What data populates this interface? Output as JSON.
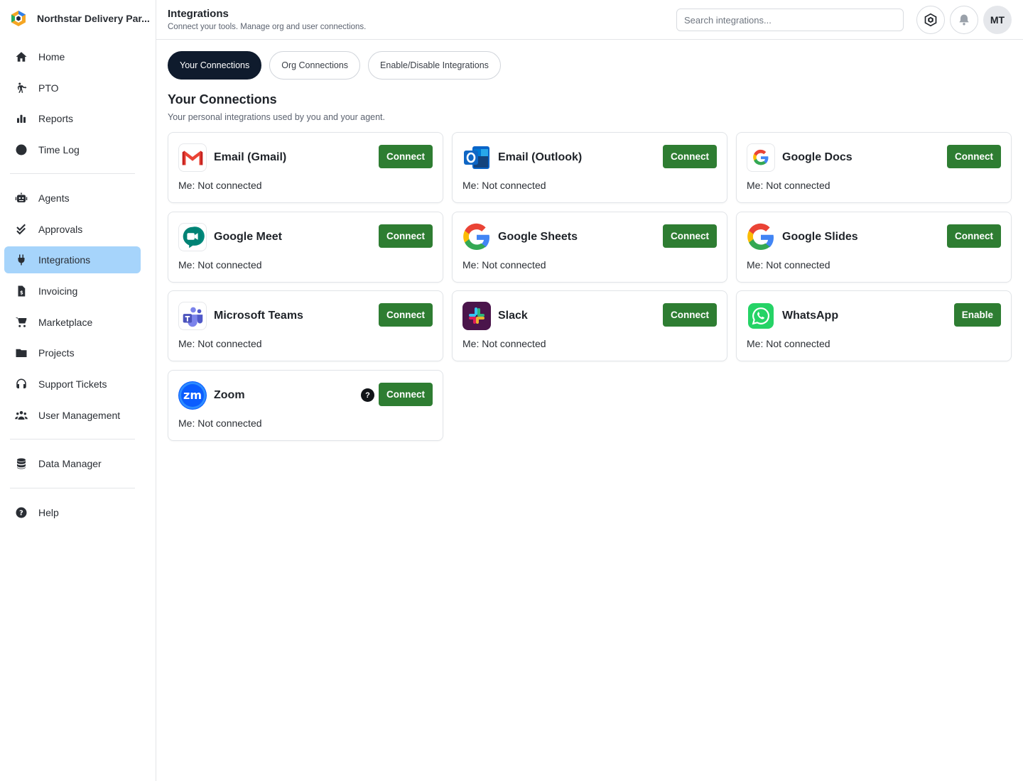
{
  "brand": {
    "name": "Northstar Delivery Par..."
  },
  "nav": {
    "group1": [
      {
        "label": "Home",
        "icon": "home-icon"
      },
      {
        "label": "PTO",
        "icon": "walking-icon"
      },
      {
        "label": "Reports",
        "icon": "bar-chart-icon"
      },
      {
        "label": "Time Log",
        "icon": "clock-icon"
      }
    ],
    "group2": [
      {
        "label": "Agents",
        "icon": "robot-icon"
      },
      {
        "label": "Approvals",
        "icon": "check-double-icon"
      },
      {
        "label": "Integrations",
        "icon": "plug-icon",
        "active": true
      },
      {
        "label": "Invoicing",
        "icon": "invoice-icon"
      },
      {
        "label": "Marketplace",
        "icon": "cart-icon"
      },
      {
        "label": "Projects",
        "icon": "folder-icon"
      },
      {
        "label": "Support Tickets",
        "icon": "headset-icon"
      },
      {
        "label": "User Management",
        "icon": "users-icon"
      }
    ],
    "group3": [
      {
        "label": "Data Manager",
        "icon": "database-icon"
      }
    ],
    "group4": [
      {
        "label": "Help",
        "icon": "help-circle-icon"
      }
    ]
  },
  "header": {
    "title": "Integrations",
    "subtitle": "Connect your tools. Manage org and user connections.",
    "search_placeholder": "Search integrations...",
    "avatar_initials": "MT"
  },
  "tabs": [
    {
      "label": "Your Connections",
      "active": true
    },
    {
      "label": "Org Connections"
    },
    {
      "label": "Enable/Disable Integrations"
    }
  ],
  "section": {
    "title": "Your Connections",
    "subtitle": "Your personal integrations used by you and your agent."
  },
  "integrations": [
    {
      "name": "Email (Gmail)",
      "status": "Me: Not connected",
      "action": "Connect",
      "icon": "gmail-icon"
    },
    {
      "name": "Email (Outlook)",
      "status": "Me: Not connected",
      "action": "Connect",
      "icon": "outlook-icon"
    },
    {
      "name": "Google Docs",
      "status": "Me: Not connected",
      "action": "Connect",
      "icon": "google-icon"
    },
    {
      "name": "Google Meet",
      "status": "Me: Not connected",
      "action": "Connect",
      "icon": "google-meet-icon"
    },
    {
      "name": "Google Sheets",
      "status": "Me: Not connected",
      "action": "Connect",
      "icon": "google-icon"
    },
    {
      "name": "Google Slides",
      "status": "Me: Not connected",
      "action": "Connect",
      "icon": "google-icon"
    },
    {
      "name": "Microsoft Teams",
      "status": "Me: Not connected",
      "action": "Connect",
      "icon": "teams-icon"
    },
    {
      "name": "Slack",
      "status": "Me: Not connected",
      "action": "Connect",
      "icon": "slack-icon"
    },
    {
      "name": "WhatsApp",
      "status": "Me: Not connected",
      "action": "Enable",
      "icon": "whatsapp-icon"
    },
    {
      "name": "Zoom",
      "status": "Me: Not connected",
      "action": "Connect",
      "icon": "zoom-icon",
      "help": "?"
    }
  ],
  "colors": {
    "accent": "#2e7d32",
    "active_nav": "#a6d4fb",
    "active_tab": "#0f1b2d"
  }
}
